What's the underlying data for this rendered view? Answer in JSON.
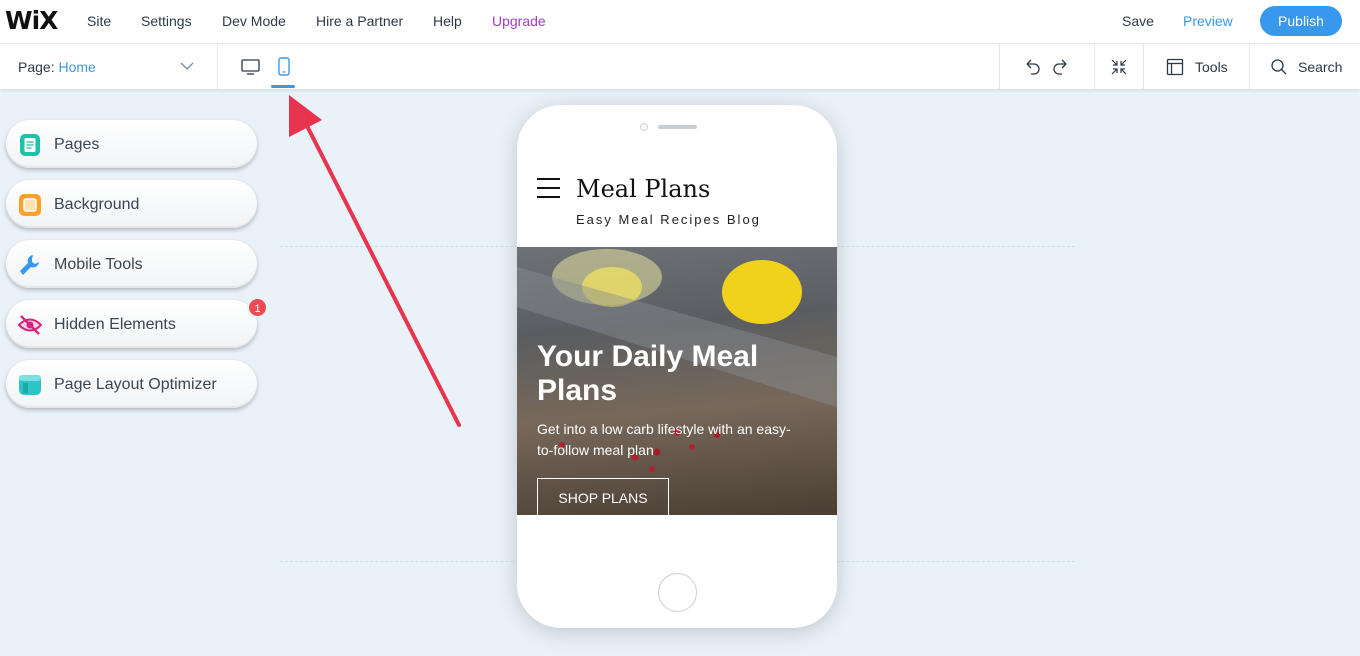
{
  "topbar": {
    "logo": "WiX",
    "menu": [
      "Site",
      "Settings",
      "Dev Mode",
      "Hire a Partner",
      "Help",
      "Upgrade"
    ],
    "save": "Save",
    "preview": "Preview",
    "publish": "Publish"
  },
  "subbar": {
    "page_label": "Page:",
    "page_value": "Home",
    "tools": "Tools",
    "search": "Search"
  },
  "sidebar": {
    "items": [
      {
        "label": "Pages",
        "icon": "pages-icon",
        "color": "#20c1a6"
      },
      {
        "label": "Background",
        "icon": "background-icon",
        "color": "#fca22b"
      },
      {
        "label": "Mobile Tools",
        "icon": "wrench-icon",
        "color": "#3899ec"
      },
      {
        "label": "Hidden Elements",
        "icon": "hidden-eye-icon",
        "color": "#d9237d"
      },
      {
        "label": "Page Layout Optimizer",
        "icon": "layout-icon",
        "color": "#2cc5c5"
      }
    ],
    "hidden_badge": "1"
  },
  "phone": {
    "site_title": "Meal Plans",
    "site_subtitle": "Easy Meal Recipes Blog",
    "hero_title": "Your Daily Meal Plans",
    "hero_text": "Get into a low carb lifestyle with an easy-to-follow meal plan",
    "hero_button": "SHOP PLANS"
  },
  "colors": {
    "accent": "#3899ec",
    "upgrade": "#a23cc0",
    "annotation_arrow": "#e8344e",
    "canvas_bg": "#eaf2f9"
  }
}
